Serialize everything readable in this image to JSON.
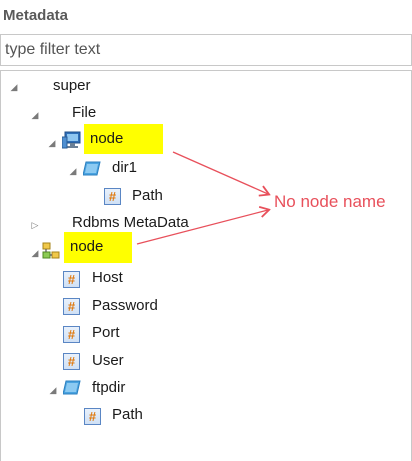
{
  "panel": {
    "title": "Metadata"
  },
  "filter": {
    "placeholder": "type filter text"
  },
  "tree": {
    "super": "super",
    "file": "File",
    "node1": "node",
    "dir1": "dir1",
    "path1": "Path",
    "rdbms": "Rdbms MetaData",
    "node2": "node",
    "host": "Host",
    "password": "Password",
    "port": "Port",
    "user": "User",
    "ftpdir": "ftpdir",
    "path2": "Path"
  },
  "annotation": {
    "text": "No node name"
  },
  "colors": {
    "highlight": "#ffff00",
    "annotation": "#e8505b",
    "hash_icon": "#e07a10",
    "folder": "#4aa3e0"
  },
  "icons": {
    "expanded": "triangle-expanded-icon",
    "collapsed": "triangle-collapsed-icon",
    "hash": "hash-icon",
    "folder": "folder-icon",
    "computer": "computer-icon",
    "network": "network-node-icon"
  }
}
